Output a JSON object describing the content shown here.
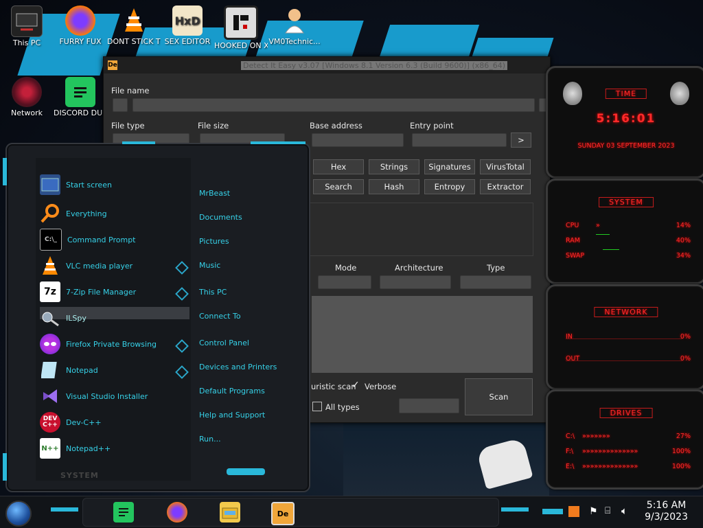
{
  "desktop": {
    "icons": [
      {
        "label": "This PC"
      },
      {
        "label": "FURRY FUX"
      },
      {
        "label": "DONT STICK THIS IN YO"
      },
      {
        "label": "SEX EDITOR"
      },
      {
        "label": "HOOKED ON XONIX"
      },
      {
        "label": "VM0Technic..."
      },
      {
        "label": "Network"
      },
      {
        "label": "DISCORD DUMBAS"
      }
    ],
    "wallpaper_text": "MrBeast"
  },
  "die_window": {
    "title": "Detect It Easy v3.07 [Windows 8.1 Version 6.3 (Build 9600)] (x86_64)",
    "file_name_label": "File name",
    "file_type_label": "File type",
    "file_size_label": "File size",
    "base_address_label": "Base address",
    "entry_point_label": "Entry point",
    "entry_point_button": ">",
    "buttons_row1": [
      "Hex",
      "Strings",
      "Signatures",
      "VirusTotal"
    ],
    "buttons_row2": [
      "Search",
      "Hash",
      "Entropy",
      "Extractor"
    ],
    "mode_label": "Mode",
    "architecture_label": "Architecture",
    "type_label": "Type",
    "heuristic_scan_label": "uristic scan",
    "verbose_label": "Verbose",
    "verbose_checked": true,
    "all_types_label": "All types",
    "all_types_checked": false,
    "scan_button": "Scan"
  },
  "start_menu": {
    "left_items": [
      {
        "label": "Start screen",
        "icon": "start-screen-icon"
      },
      {
        "label": "Everything",
        "icon": "everything-search-icon"
      },
      {
        "label": "Command Prompt",
        "icon": "command-prompt-icon"
      },
      {
        "label": "VLC media player",
        "icon": "vlc-icon"
      },
      {
        "label": "7-Zip File Manager",
        "icon": "seven-zip-icon"
      },
      {
        "label": "ILSpy",
        "icon": "ilspy-icon"
      },
      {
        "label": "Firefox Private Browsing",
        "icon": "firefox-private-icon"
      },
      {
        "label": "Notepad",
        "icon": "notepad-icon"
      },
      {
        "label": "Visual Studio Installer",
        "icon": "visual-studio-installer-icon"
      },
      {
        "label": "Dev-C++",
        "icon": "dev-cpp-icon"
      },
      {
        "label": "Notepad++",
        "icon": "notepad-plus-plus-icon"
      }
    ],
    "right_items": [
      "MrBeast",
      "Documents",
      "Pictures",
      "Music",
      "This PC",
      "Connect To",
      "Control Panel",
      "Devices and Printers",
      "Default Programs",
      "Help and Support",
      "Run..."
    ],
    "footer_label": "SYSTEM"
  },
  "gadgets": {
    "time": {
      "title": "TIME",
      "clock": "5:16:01",
      "date": "SUNDAY 03 SEPTEMBER 2023"
    },
    "system": {
      "title": "SYSTEM",
      "rows": [
        {
          "label": "CPU",
          "value": "14%"
        },
        {
          "label": "RAM",
          "value": "40%"
        },
        {
          "label": "SWAP",
          "value": "34%"
        }
      ]
    },
    "network": {
      "title": "NETWORK",
      "rows": [
        {
          "label": "IN",
          "value": "0%"
        },
        {
          "label": "OUT",
          "value": "0%"
        }
      ]
    },
    "drives": {
      "title": "DRIVES",
      "rows": [
        {
          "label": "C:\\",
          "value": "27%"
        },
        {
          "label": "F:\\",
          "value": "100%"
        },
        {
          "label": "E:\\",
          "value": "100%"
        }
      ]
    }
  },
  "taskbar": {
    "clock_time": "5:16 AM",
    "clock_date": "9/3/2023",
    "pinned": [
      "discord-icon",
      "firefox-icon",
      "file-explorer-icon",
      "detect-it-easy-icon"
    ]
  },
  "colors": {
    "accent_cyan": "#36d1e8",
    "gadget_red": "#ff2a2a",
    "window_bg": "#2b2b2b"
  }
}
